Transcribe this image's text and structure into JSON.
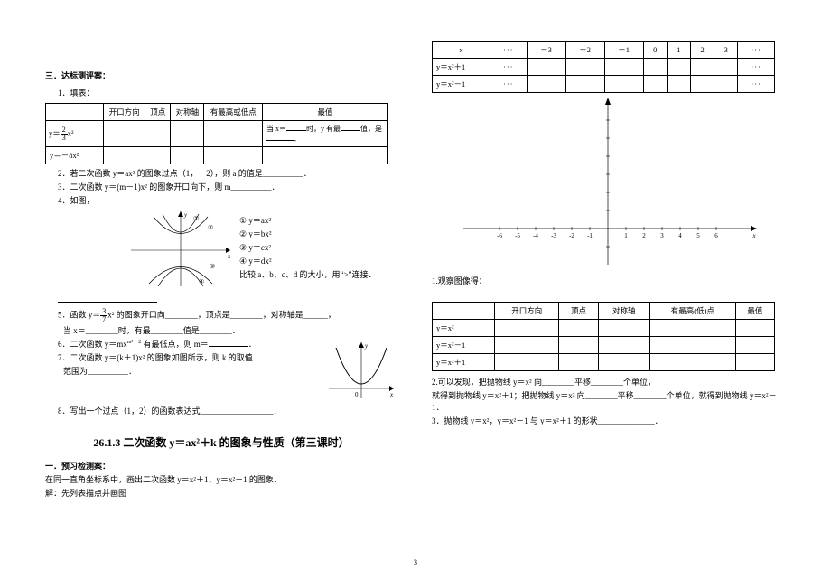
{
  "left": {
    "sec3_title": "三．达标测评案：",
    "q1": "1．填表：",
    "t1": {
      "h1": "开口方向",
      "h2": "顶点",
      "h3": "对称轴",
      "h4": "有最高或低点",
      "h5": "最值",
      "r1c0_pre": "y＝",
      "r1c0_num": "2",
      "r1c0_den": "3",
      "r1c0_post": "x²",
      "r1_val": "当 x＝____时，y 有最____值，是______．",
      "r2c0": "y＝－8x²"
    },
    "q2": "2．若二次函数 y＝ax² 的图象过点（1，－2），则 a 的值是__________．",
    "q3": "3．二次函数 y＝(m－1)x² 的图象开口向下，则 m__________．",
    "q4": "4．如图，",
    "q4_lines": {
      "l1": "①  y＝ax²",
      "l2": "②  y＝bx²",
      "l3": "③  y＝cx²",
      "l4": "④  y＝dx²",
      "cmp": "比较 a、b、c、d 的大小，用“>”连接．"
    },
    "q4_blank": "____________________",
    "q5a": "5．函数 y＝",
    "q5_num": "3",
    "q5_den": "7",
    "q5b": "x² 的图象开口向________，顶点是________，对称轴是______，",
    "q5c": "当 x＝________时，有最________值是________．",
    "q6": "6．二次函数 y＝mx^(m²－2) 有最低点，则 m＝__________．",
    "q7a": "7．二次函数 y＝(k＋1)x² 的图象如图所示，则 k 的取值",
    "q7b": "范围为__________．",
    "q8": "8．写出一个过点（1，2）的函数表达式__________________．",
    "heading3": "26.1.3 二次函数 y＝ax²＋k 的图象与性质（第三课时）",
    "sec1_title": "一．预习检测案：",
    "pre1": "在同一直角坐标系中，画出二次函数 y＝x²＋1，y＝x²－1 的图象．",
    "pre2": "解：先列表描点并画图"
  },
  "right": {
    "t2": {
      "hx": "x",
      "dots": "···",
      "hv": [
        "－3",
        "－2",
        "－1",
        "0",
        "1",
        "2",
        "3"
      ],
      "r1": "y＝x²＋1",
      "r2": "y＝x²－1"
    },
    "axis_x_ticks": [
      "-6",
      "-5",
      "-4",
      "-3",
      "-2",
      "-1",
      "1",
      "2",
      "3",
      "4",
      "5",
      "6"
    ],
    "obs1": "1.观察图像得：",
    "t3": {
      "h1": "开口方向",
      "h2": "顶点",
      "h3": "对称轴",
      "h4": "有最高(低)点",
      "h5": "最值",
      "r1": "y＝x²",
      "r2": "y＝x²－1",
      "r3": "y＝x²＋1"
    },
    "c2a": "2.可以发现，把抛物线 y＝x² 向________平移________个单位，",
    "c2b": "就得到抛物线 y＝x²＋1；把抛物线 y＝x² 向________平移________个单位，就得到抛物线 y＝x²－1．",
    "c3": "3．抛物线 y＝x²，y＝x²－1 与 y＝x²＋1 的形状______________．"
  },
  "page_num": "3"
}
